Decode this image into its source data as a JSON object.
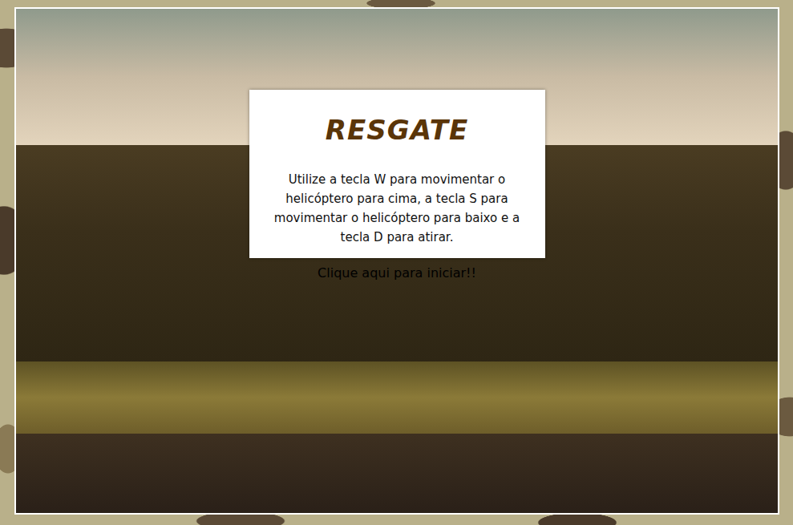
{
  "title": "RESGATE",
  "instructions": "Utilize a tecla W para movimentar o helicóptero para cima, a tecla S para movimentar o helicóptero para baixo e a tecla D para atirar.",
  "start_link": "Clique aqui para iniciar!!"
}
